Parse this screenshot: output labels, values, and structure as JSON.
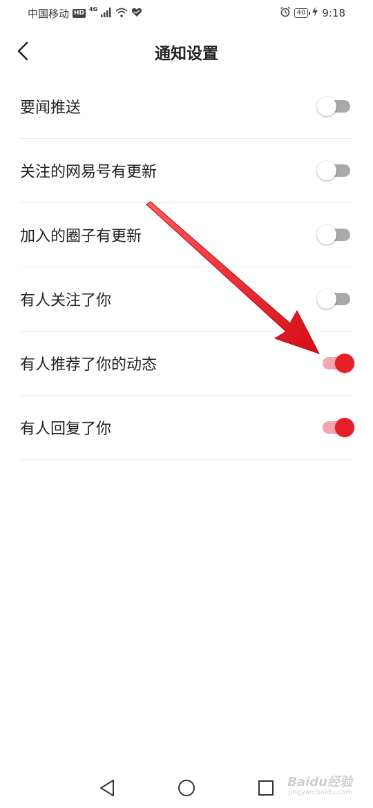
{
  "status_bar": {
    "carrier": "中国移动",
    "hd_badge": "HD",
    "network_tag": "4G",
    "battery": "40",
    "time": "9:18",
    "icons": [
      "signal-icon",
      "wifi-icon",
      "heart-icon",
      "alarm-icon",
      "charging-icon"
    ]
  },
  "header": {
    "title": "通知设置",
    "back_icon": "chevron-left-icon"
  },
  "settings": [
    {
      "label": "要闻推送",
      "enabled": false
    },
    {
      "label": "关注的网易号有更新",
      "enabled": false
    },
    {
      "label": "加入的圈子有更新",
      "enabled": false
    },
    {
      "label": "有人关注了你",
      "enabled": false
    },
    {
      "label": "有人推荐了你的动态",
      "enabled": true
    },
    {
      "label": "有人回复了你",
      "enabled": true
    }
  ],
  "colors": {
    "accent": "#e61e28",
    "accent_track": "#f3a7ab",
    "off_track": "#a9a9a9",
    "annotation_arrow": "#e8141c"
  },
  "nav_bar": {
    "icons": [
      "back-triangle-icon",
      "home-circle-icon",
      "recents-square-icon"
    ]
  },
  "watermark": {
    "text": "Baidu经验",
    "sub": "jingyan.baidu.com"
  }
}
